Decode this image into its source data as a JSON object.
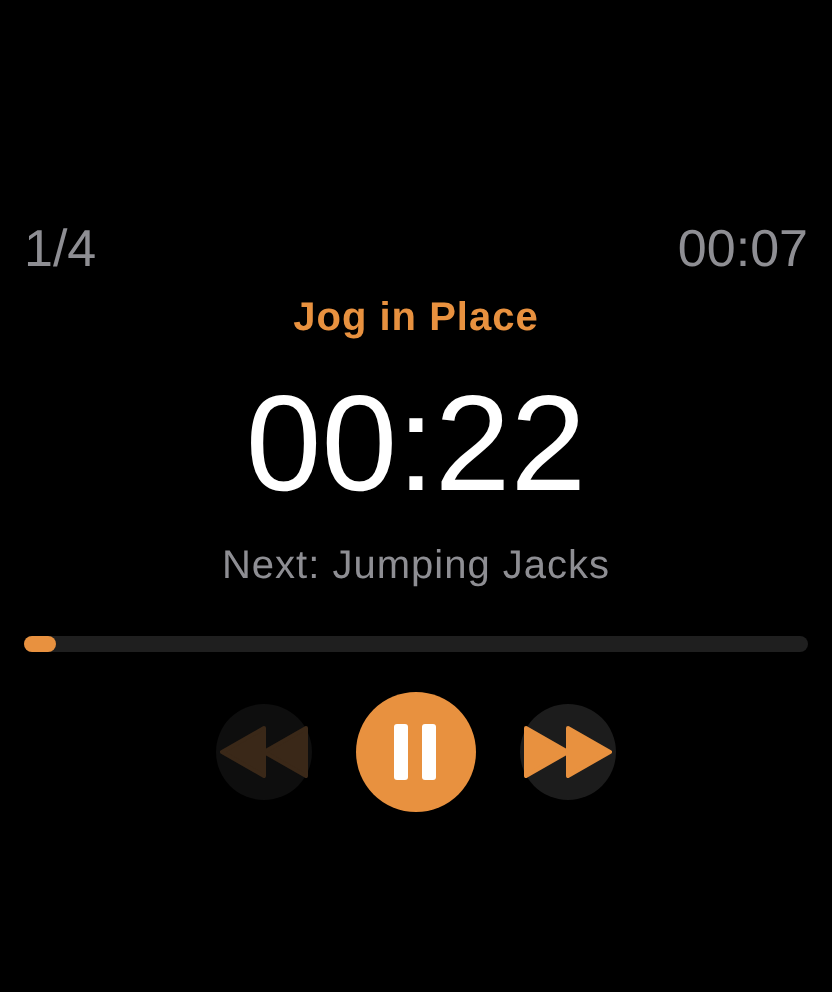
{
  "counter": "1/4",
  "elapsed": "00:07",
  "exercise": "Jog in Place",
  "remaining": "00:22",
  "next": "Next: Jumping Jacks",
  "progress": {
    "level": 0.04
  },
  "controls": [
    {
      "kind": "rewind",
      "disabled": true
    },
    {
      "kind": "pause",
      "disabled": false
    },
    {
      "kind": "forward",
      "disabled": false
    }
  ]
}
